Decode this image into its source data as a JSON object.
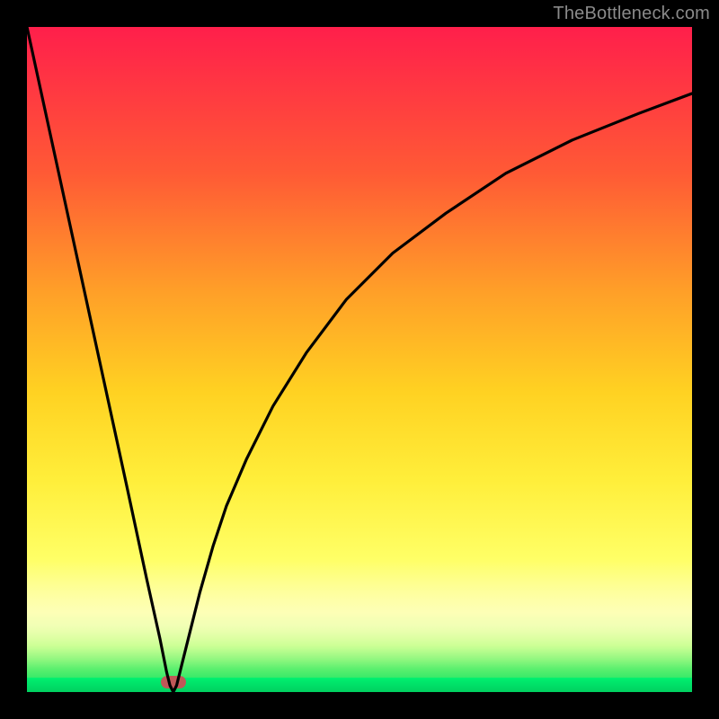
{
  "watermark": "TheBottleneck.com",
  "chart_data": {
    "type": "line",
    "title": "",
    "xlabel": "",
    "ylabel": "",
    "xlim": [
      0,
      100
    ],
    "ylim": [
      0,
      100
    ],
    "grid": false,
    "legend": false,
    "series": [
      {
        "name": "curve",
        "x": [
          0,
          5,
          10,
          15,
          18,
          20,
          21,
          21.5,
          22,
          22.5,
          23,
          24,
          26,
          28,
          30,
          33,
          37,
          42,
          48,
          55,
          63,
          72,
          82,
          92,
          100
        ],
        "y": [
          100,
          77,
          54,
          31,
          17,
          8,
          3,
          1,
          0,
          1,
          3,
          7,
          15,
          22,
          28,
          35,
          43,
          51,
          59,
          66,
          72,
          78,
          83,
          87,
          90
        ]
      }
    ],
    "annotations": [
      {
        "type": "marker",
        "shape": "pill",
        "x": 22,
        "y": 0,
        "color": "#c05858"
      }
    ],
    "background_gradient": {
      "top": "#ff1f4b",
      "mid1": "#ffa028",
      "mid2": "#ffee3a",
      "bottom": "#00e060"
    }
  },
  "marker": {
    "x_percent": 22
  }
}
